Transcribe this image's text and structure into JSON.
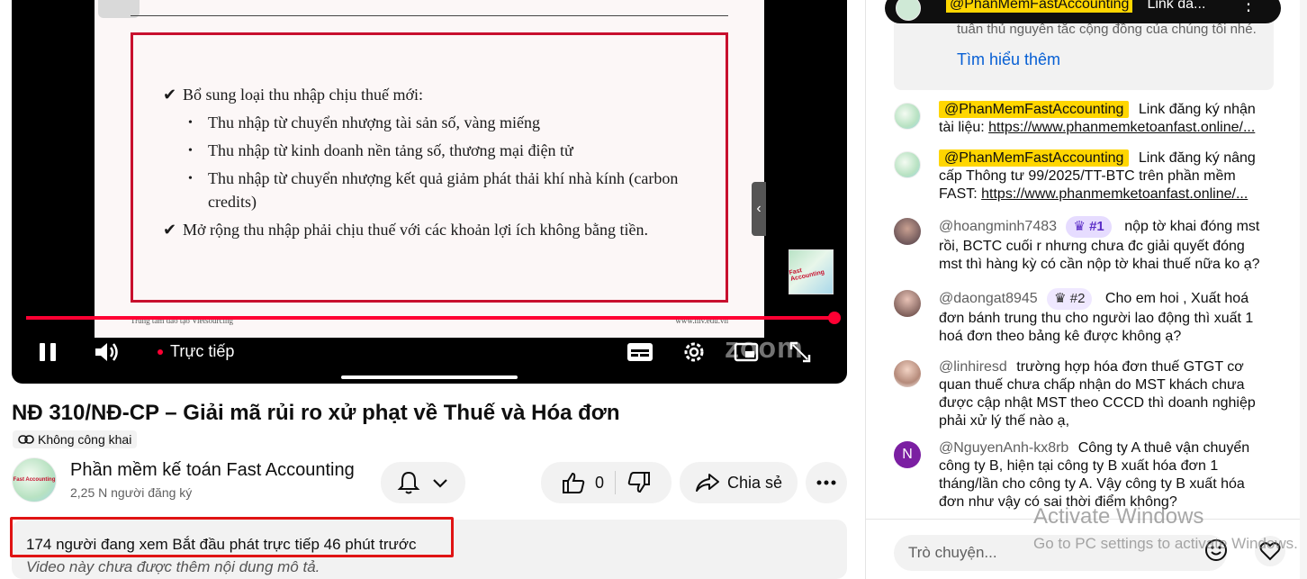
{
  "video": {
    "slide": {
      "check_1": "Bổ sung loại thu nhập chịu thuế mới:",
      "bullets": [
        "Thu nhập từ chuyển nhượng tài sản số, vàng miếng",
        "Thu nhập từ kinh doanh nền tảng số, thương mại điện tử",
        "Thu nhập từ chuyển nhượng kết quả giảm phát thải khí nhà kính (carbon credits)"
      ],
      "check_2": "Mở rộng thu nhập phải chịu thuế với các khoản lợi ích không bằng tiền.",
      "footer_left": "Trung tâm đào tạo Vietsourcing",
      "footer_right": "www.nlv.edu.vn",
      "logo_text": "Fast Accounting"
    },
    "live_label": "Trực tiếp",
    "watermark": "zoom",
    "progress": 1.0
  },
  "title": "NĐ 310/NĐ-CP – Giải mã rủi ro xử phạt về Thuế và Hóa đơn",
  "privacy_label": "Không công khai",
  "channel": {
    "name": "Phần mềm kế toán Fast Accounting",
    "subscribers": "2,25 N người đăng ký",
    "avatar_text": "Fast Accounting"
  },
  "actions": {
    "like_count": "0",
    "share_label": "Chia sẻ"
  },
  "description": {
    "stats": "174 người đang xem  Bắt đầu phát trực tiếp 46 phút trước",
    "empty": "Video này chưa được thêm nội dung mô tả."
  },
  "chat": {
    "pinned": {
      "author": "@PhanMemFastAccounting",
      "text": "Link đă..."
    },
    "notice": {
      "text": "tuân thủ nguyên tắc cộng đồng của chúng tôi nhé.",
      "link": "Tìm hiểu thêm"
    },
    "messages": [
      {
        "author": "@PhanMemFastAccounting",
        "text": "Link đăng ký nhận tài liệu: ",
        "link": "https://www.phanmemketoanfast.online/..."
      },
      {
        "author": "@PhanMemFastAccounting",
        "text": "Link đăng ký nâng cấp Thông tư 99/2025/TT-BTC trên phần mềm FAST: ",
        "link": "https://www.phanmemketoanfast.online/..."
      },
      {
        "author": "@hoangminh7483",
        "badge": "#1",
        "text": "nộp tờ khai đóng mst rồi, BCTC cuối r nhưng chưa đc giải quyết đóng mst thì hàng kỳ có cần nộp tờ khai thuế nữa ko ạ?"
      },
      {
        "author": "@daongat8945",
        "badge": "#2",
        "text": "Cho em hoi , Xuất hoá đơn bánh trung thu cho người lao động thì xuất 1 hoá đơn theo bảng kê được không ạ?"
      },
      {
        "author": "@linhiresd",
        "text": "trường hợp hóa đơn thuế GTGT cơ quan thuế chưa chấp nhận do MST khách chưa được cập nhật MST theo CCCD thì doanh nghiệp phải xử lý thế nào ạ,"
      },
      {
        "author": "@NguyenAnh-kx8rb",
        "avatar_letter": "N",
        "text": "Công ty A thuê vận chuyển công ty B, hiện tại công ty B xuất hóa đơn 1 tháng/lần cho công ty A. Vậy công ty B xuất hóa đơn như vậy có sai thời điểm không?"
      }
    ],
    "input_placeholder": "Trò chuyện..."
  },
  "os_watermark": {
    "line1": "Activate Windows",
    "line2": "Go to PC settings to activate Windows."
  },
  "colors": {
    "accent_red": "#ff0033",
    "owner_tag": "#ffd600",
    "link_blue": "#065fd4"
  }
}
